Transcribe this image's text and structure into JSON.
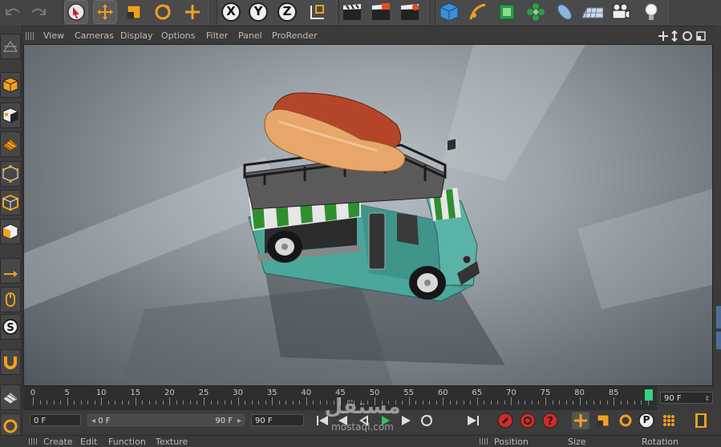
{
  "toolbar": {
    "axis_x": "X",
    "axis_y": "Y",
    "axis_z": "Z",
    "icons": [
      "undo-icon",
      "redo-icon",
      "live-selection-icon",
      "move-icon",
      "scale-icon",
      "rotate-icon",
      "recent-tool-icon",
      "x-axis-lock",
      "y-axis-lock",
      "z-axis-lock",
      "coordinate-system-icon",
      "render-view-icon",
      "render-picture-viewer-icon",
      "render-settings-icon",
      "cube-object-icon",
      "pen-spline-icon",
      "subdivision-icon",
      "cloner-icon",
      "deformer-icon",
      "floor-icon",
      "camera-icon",
      "light-icon"
    ]
  },
  "viewport_menu": {
    "view": "View",
    "cameras": "Cameras",
    "display": "Display",
    "options": "Options",
    "filter": "Filter",
    "panel": "Panel",
    "prorender": "ProRender"
  },
  "timeline": {
    "ticks": [
      "0",
      "5",
      "10",
      "15",
      "20",
      "25",
      "30",
      "35",
      "40",
      "45",
      "50",
      "55",
      "60",
      "65",
      "70",
      "75",
      "80",
      "85"
    ],
    "end_field": "90 F"
  },
  "controls": {
    "current_frame": "0 F",
    "range_start": "0 F",
    "range_end": "90 F",
    "max_frame": "90 F",
    "p_label": "P"
  },
  "watermark": {
    "arabic": "مستقل",
    "latin": "mostaql.com"
  },
  "bottom_menu": {
    "create": "Create",
    "edit": "Edit",
    "function": "Function",
    "texture": "Texture",
    "position": "Position",
    "size": "Size",
    "rotation": "Rotation"
  },
  "colors": {
    "accent_orange": "#f0a020",
    "truck_teal": "#4aa79a",
    "awning_green": "#2f8f2f",
    "sausage": "#b5452a",
    "bun": "#e8a66b"
  }
}
